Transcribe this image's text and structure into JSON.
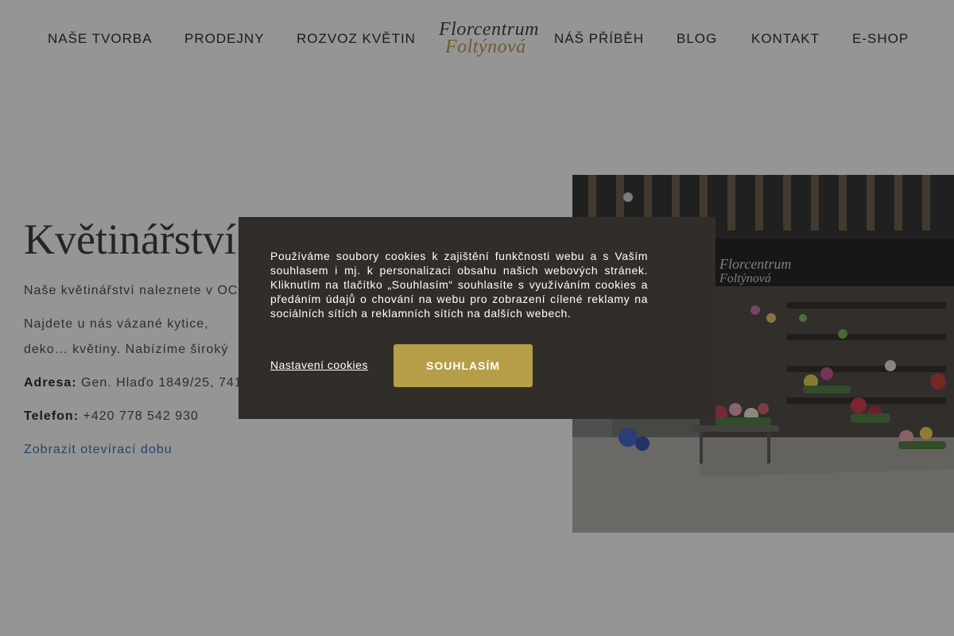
{
  "nav": {
    "left": [
      "NAŠE TVORBA",
      "PRODEJNY",
      "ROZVOZ KVĚTIN"
    ],
    "right": [
      "NÁŠ PŘÍBĚH",
      "BLOG",
      "KONTAKT",
      "E-SHOP"
    ]
  },
  "logo": {
    "line1": "Florcentrum",
    "line2": "Foltýnová"
  },
  "main": {
    "title": "Květinářství",
    "para1": "Naše květinářství naleznete v OC ",
    "para2": "Najdete u nás vázané kytice, deko… květiny. Nabízíme široký výběr kvě…",
    "address_label": "Adresa:",
    "address_value": "Gen. Hlaďo 1849/25, 741",
    "phone_label": "Telefon:",
    "phone_value": "+420 778 542 930",
    "hours_link": "Zobrazit otevírací dobu"
  },
  "photo": {
    "sign_line1": "Florcentrum",
    "sign_line2": "Foltýnová"
  },
  "cookie": {
    "text": "Používáme soubory cookies k zajištění funkčnosti webu a s Vaším souhlasem i mj. k personalizaci obsahu našich webových stránek. Kliknutím na tlačítko „Souhlasím“ souhlasíte s využíváním cookies a předáním údajů o chování na webu pro zobrazení cílené reklamy na sociálních sítích a reklamních sítích na dalších webech.",
    "settings_label": "Nastavení cookies",
    "accept_label": "SOUHLASÍM"
  },
  "colors": {
    "accent_gold": "#b59e47",
    "modal_bg": "#312d29",
    "link_blue": "#2e74b5"
  }
}
